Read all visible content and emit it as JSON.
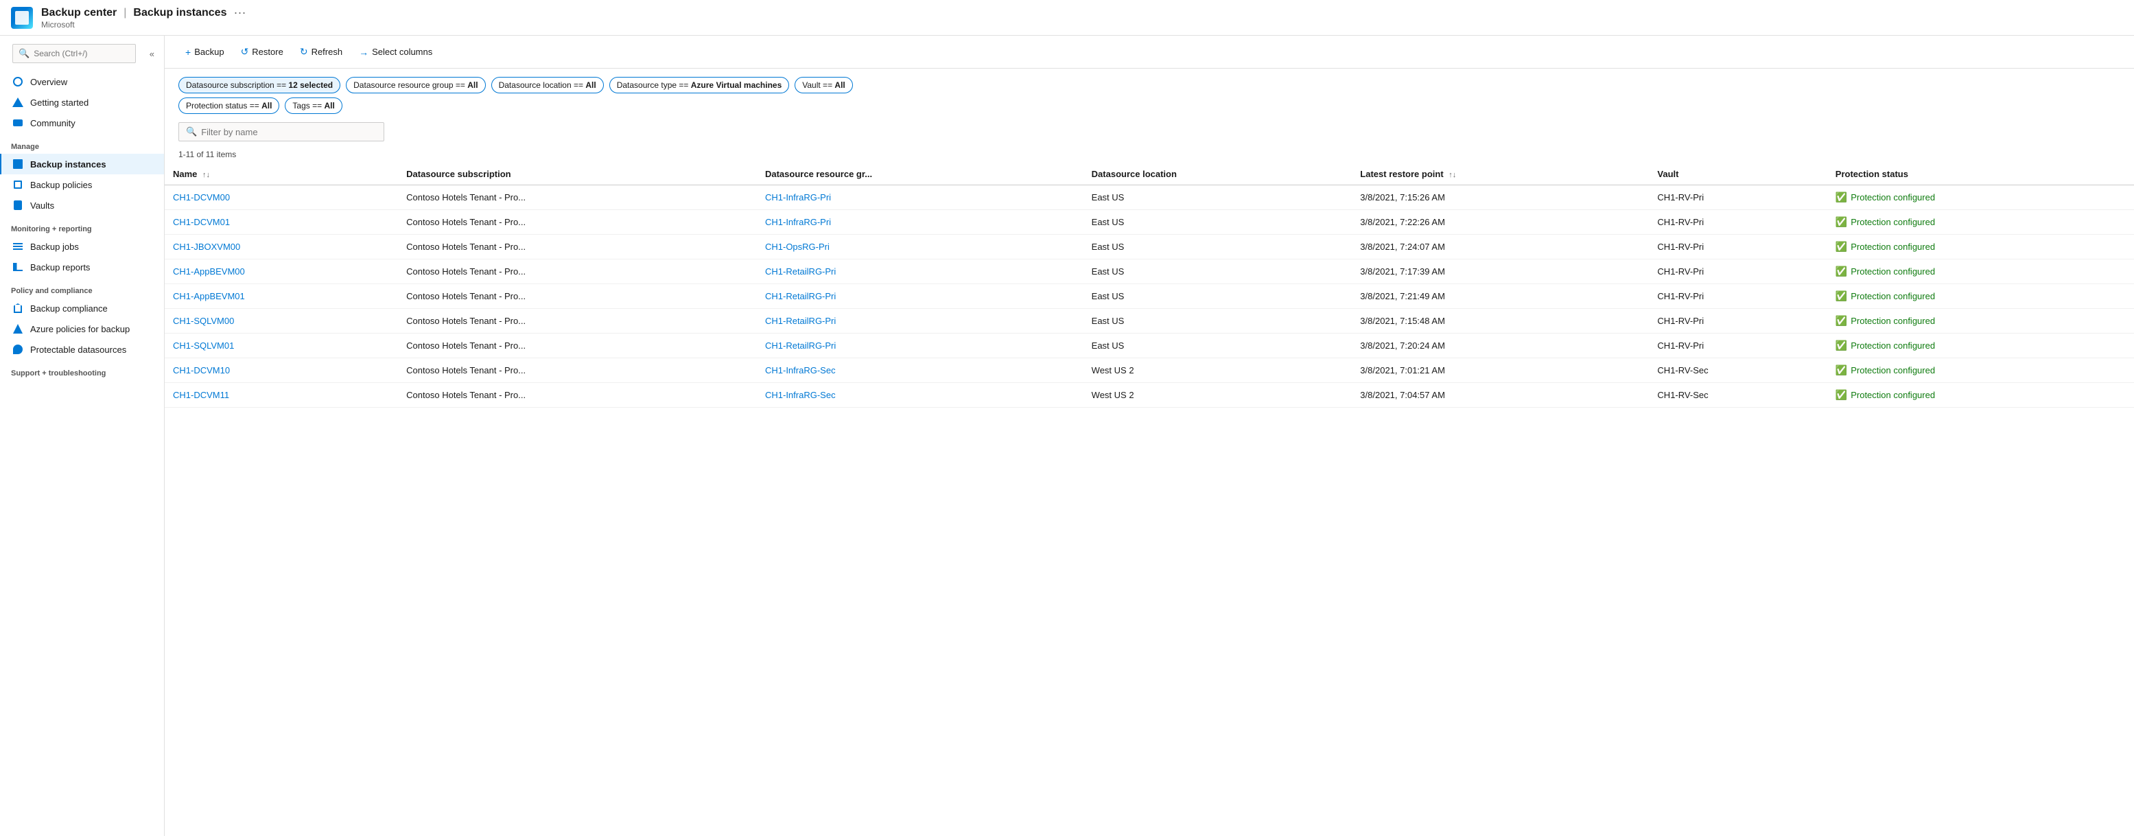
{
  "header": {
    "app_name": "Backup center",
    "separator": "|",
    "page_name": "Backup instances",
    "subtitle": "Microsoft"
  },
  "sidebar": {
    "search_placeholder": "Search (Ctrl+/)",
    "collapse_icon": "«",
    "nav_items": [
      {
        "id": "overview",
        "label": "Overview",
        "icon": "overview-icon",
        "section": null
      },
      {
        "id": "getting-started",
        "label": "Getting started",
        "icon": "getting-started-icon",
        "section": null
      },
      {
        "id": "community",
        "label": "Community",
        "icon": "community-icon",
        "section": null
      }
    ],
    "sections": [
      {
        "label": "Manage",
        "items": [
          {
            "id": "backup-instances",
            "label": "Backup instances",
            "icon": "backup-instances-icon",
            "active": true
          },
          {
            "id": "backup-policies",
            "label": "Backup policies",
            "icon": "backup-policies-icon",
            "active": false
          },
          {
            "id": "vaults",
            "label": "Vaults",
            "icon": "vaults-icon",
            "active": false
          }
        ]
      },
      {
        "label": "Monitoring + reporting",
        "items": [
          {
            "id": "backup-jobs",
            "label": "Backup jobs",
            "icon": "backup-jobs-icon",
            "active": false
          },
          {
            "id": "backup-reports",
            "label": "Backup reports",
            "icon": "backup-reports-icon",
            "active": false
          }
        ]
      },
      {
        "label": "Policy and compliance",
        "items": [
          {
            "id": "backup-compliance",
            "label": "Backup compliance",
            "icon": "compliance-icon",
            "active": false
          },
          {
            "id": "azure-policies",
            "label": "Azure policies for backup",
            "icon": "az-policies-icon",
            "active": false
          },
          {
            "id": "protectable-datasources",
            "label": "Protectable datasources",
            "icon": "protectable-icon",
            "active": false
          }
        ]
      },
      {
        "label": "Support + troubleshooting",
        "items": []
      }
    ]
  },
  "toolbar": {
    "buttons": [
      {
        "id": "backup",
        "label": "Backup",
        "icon": "+"
      },
      {
        "id": "restore",
        "label": "Restore",
        "icon": "↺"
      },
      {
        "id": "refresh",
        "label": "Refresh",
        "icon": "↻"
      },
      {
        "id": "select-columns",
        "label": "Select columns",
        "icon": "→"
      }
    ]
  },
  "filters": [
    {
      "id": "datasource-subscription",
      "label": "Datasource subscription == 12 selected",
      "active": true
    },
    {
      "id": "datasource-rg",
      "label": "Datasource resource group == All",
      "active": false
    },
    {
      "id": "datasource-location",
      "label": "Datasource location == All",
      "active": false
    },
    {
      "id": "datasource-type",
      "label": "Datasource type == Azure Virtual machines",
      "active": false
    },
    {
      "id": "vault",
      "label": "Vault == All",
      "active": false
    },
    {
      "id": "protection-status",
      "label": "Protection status == All",
      "active": false
    },
    {
      "id": "tags",
      "label": "Tags == All",
      "active": false
    }
  ],
  "search": {
    "placeholder": "Filter by name"
  },
  "table": {
    "meta": "1-11 of 11 items",
    "columns": [
      {
        "id": "name",
        "label": "Name",
        "sortable": true
      },
      {
        "id": "datasource-subscription",
        "label": "Datasource subscription",
        "sortable": false
      },
      {
        "id": "datasource-rg",
        "label": "Datasource resource gr...",
        "sortable": false
      },
      {
        "id": "datasource-location",
        "label": "Datasource location",
        "sortable": false
      },
      {
        "id": "latest-restore-point",
        "label": "Latest restore point",
        "sortable": true
      },
      {
        "id": "vault",
        "label": "Vault",
        "sortable": false
      },
      {
        "id": "protection-status",
        "label": "Protection status",
        "sortable": false
      }
    ],
    "rows": [
      {
        "name": "CH1-DCVM00",
        "subscription": "Contoso Hotels Tenant - Pro...",
        "rg": "CH1-InfraRG-Pri",
        "location": "East US",
        "restore_point": "3/8/2021, 7:15:26 AM",
        "vault": "CH1-RV-Pri",
        "status": "Protection configured"
      },
      {
        "name": "CH1-DCVM01",
        "subscription": "Contoso Hotels Tenant - Pro...",
        "rg": "CH1-InfraRG-Pri",
        "location": "East US",
        "restore_point": "3/8/2021, 7:22:26 AM",
        "vault": "CH1-RV-Pri",
        "status": "Protection configured"
      },
      {
        "name": "CH1-JBOXVM00",
        "subscription": "Contoso Hotels Tenant - Pro...",
        "rg": "CH1-OpsRG-Pri",
        "location": "East US",
        "restore_point": "3/8/2021, 7:24:07 AM",
        "vault": "CH1-RV-Pri",
        "status": "Protection configured"
      },
      {
        "name": "CH1-AppBEVM00",
        "subscription": "Contoso Hotels Tenant - Pro...",
        "rg": "CH1-RetailRG-Pri",
        "location": "East US",
        "restore_point": "3/8/2021, 7:17:39 AM",
        "vault": "CH1-RV-Pri",
        "status": "Protection configured"
      },
      {
        "name": "CH1-AppBEVM01",
        "subscription": "Contoso Hotels Tenant - Pro...",
        "rg": "CH1-RetailRG-Pri",
        "location": "East US",
        "restore_point": "3/8/2021, 7:21:49 AM",
        "vault": "CH1-RV-Pri",
        "status": "Protection configured"
      },
      {
        "name": "CH1-SQLVM00",
        "subscription": "Contoso Hotels Tenant - Pro...",
        "rg": "CH1-RetailRG-Pri",
        "location": "East US",
        "restore_point": "3/8/2021, 7:15:48 AM",
        "vault": "CH1-RV-Pri",
        "status": "Protection configured"
      },
      {
        "name": "CH1-SQLVM01",
        "subscription": "Contoso Hotels Tenant - Pro...",
        "rg": "CH1-RetailRG-Pri",
        "location": "East US",
        "restore_point": "3/8/2021, 7:20:24 AM",
        "vault": "CH1-RV-Pri",
        "status": "Protection configured"
      },
      {
        "name": "CH1-DCVM10",
        "subscription": "Contoso Hotels Tenant - Pro...",
        "rg": "CH1-InfraRG-Sec",
        "location": "West US 2",
        "restore_point": "3/8/2021, 7:01:21 AM",
        "vault": "CH1-RV-Sec",
        "status": "Protection configured"
      },
      {
        "name": "CH1-DCVM11",
        "subscription": "Contoso Hotels Tenant - Pro...",
        "rg": "CH1-InfraRG-Sec",
        "location": "West US 2",
        "restore_point": "3/8/2021, 7:04:57 AM",
        "vault": "CH1-RV-Sec",
        "status": "Protection configured"
      }
    ]
  }
}
